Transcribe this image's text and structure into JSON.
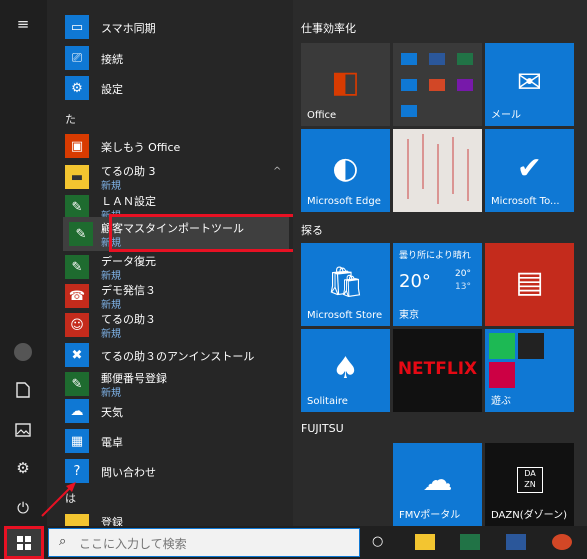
{
  "app_list": {
    "top_item": {
      "label": "スマホ同期"
    },
    "item_setsuzoku": {
      "label": "接続"
    },
    "item_settei": {
      "label": "設定"
    },
    "letter_ta": "た",
    "item_tanoshimou": {
      "label": "楽しもう Office"
    },
    "folder_terunou3": {
      "label": "てるの助 3",
      "sub": "新規"
    },
    "item_lan": {
      "label": "ＬＡＮ設定",
      "sub": "新規"
    },
    "item_kokyaku": {
      "label": "顧客マスタインポートツール",
      "sub": "新規"
    },
    "item_data": {
      "label": "データ復元",
      "sub": "新規"
    },
    "item_denpyou": {
      "label": "デモ発信３",
      "sub": "新規"
    },
    "item_terunou3b": {
      "label": "てるの助３",
      "sub": "新規"
    },
    "item_uninstall": {
      "label": "てるの助３のアンインストール"
    },
    "item_yuubin": {
      "label": "郵便番号登録",
      "sub": "新規"
    },
    "item_tenki": {
      "label": "天気"
    },
    "item_dentaku": {
      "label": "電卓"
    },
    "item_toiawase": {
      "label": "問い合わせ"
    },
    "letter_ha": "は",
    "item_bottom_partial": {
      "label": "登録"
    }
  },
  "tiles": {
    "group_shigoto": "仕事効率化",
    "office": "Office",
    "mail": "メール",
    "edge": "Microsoft Edge",
    "todo": "Microsoft To...",
    "group_saguru": "探る",
    "store": "Microsoft Store",
    "weather": {
      "cond": "曇り所により晴れ",
      "temp": "20°",
      "hi": "20°",
      "lo": "13°",
      "city": "東京"
    },
    "netflix": "NETFLIX",
    "solitaire": "Solitaire",
    "play": "遊ぶ",
    "group_fujitsu": "FUJITSU",
    "fmv": "FMVポータル",
    "dazn": "DAZN(ダゾーン)",
    "dazn_logo": "DA ZN"
  },
  "taskbar": {
    "search_placeholder": "ここに入力して検索"
  },
  "colors": {
    "tile_blue": "#0f78d4",
    "highlight_red": "#e81123",
    "folder_yellow": "#f3c530"
  }
}
